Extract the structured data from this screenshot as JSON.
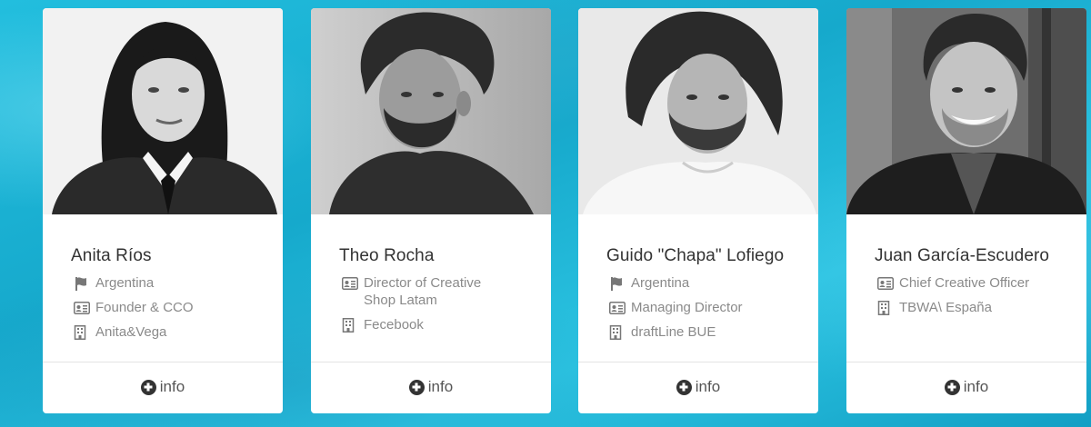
{
  "speakers": [
    {
      "name": "Anita Ríos",
      "details": [
        {
          "icon": "flag-icon",
          "text": "Argentina"
        },
        {
          "icon": "id-card-icon",
          "text": "Founder & CCO"
        },
        {
          "icon": "building-icon",
          "text": "Anita&Vega"
        }
      ],
      "info_label": "info"
    },
    {
      "name": "Theo Rocha",
      "details": [
        {
          "icon": "id-card-icon",
          "text": "Director of Creative Shop Latam"
        },
        {
          "icon": "building-icon",
          "text": "Fecebook"
        }
      ],
      "info_label": "info"
    },
    {
      "name": "Guido \"Chapa\" Lofiego",
      "details": [
        {
          "icon": "flag-icon",
          "text": "Argentina"
        },
        {
          "icon": "id-card-icon",
          "text": "Managing Director"
        },
        {
          "icon": "building-icon",
          "text": "draftLine BUE"
        }
      ],
      "info_label": "info"
    },
    {
      "name": "Juan García-Escudero",
      "details": [
        {
          "icon": "id-card-icon",
          "text": "Chief Creative Officer"
        },
        {
          "icon": "building-icon",
          "text": "TBWA\\ España"
        }
      ],
      "info_label": "info"
    }
  ],
  "colors": {
    "background": "#1cb6d6",
    "card": "#ffffff",
    "name_text": "#333333",
    "detail_text": "#8a8a8a",
    "icon": "#777777"
  }
}
